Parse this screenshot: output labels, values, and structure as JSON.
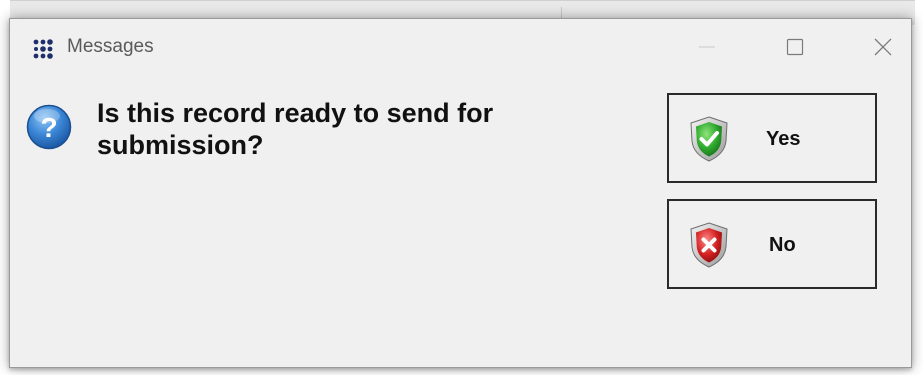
{
  "window": {
    "title": "Messages",
    "app_icon": "dots-grid-icon",
    "controls": {
      "minimize_icon": "minimize-icon",
      "maximize_icon": "maximize-icon",
      "close_icon": "close-icon"
    }
  },
  "dialog": {
    "icon": "question-icon",
    "message": "Is this record ready to send for submission?",
    "buttons": [
      {
        "label": "Yes",
        "icon": "shield-check-icon",
        "accent": "#2ea82e"
      },
      {
        "label": "No",
        "icon": "shield-x-icon",
        "accent": "#d42020"
      }
    ]
  },
  "colors": {
    "dialog_background": "#f0f0f0",
    "title_text": "#5a5a5a",
    "question_icon_blue": "#2f78c8",
    "app_icon_navy": "#1f2d6b"
  }
}
